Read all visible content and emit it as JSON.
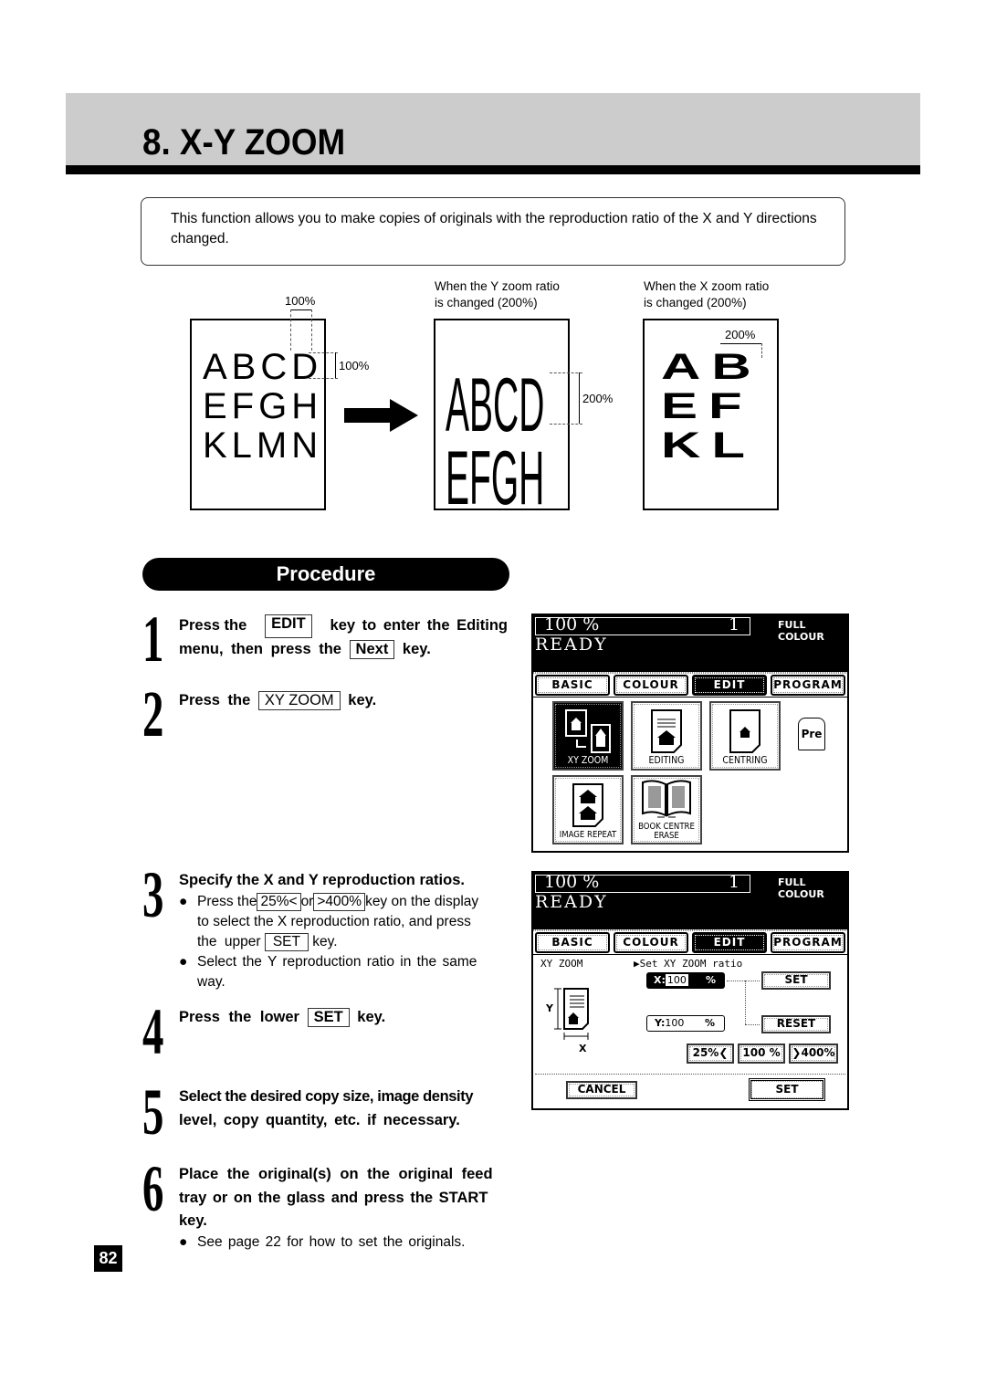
{
  "header": {
    "title": "8. X-Y ZOOM"
  },
  "intro": {
    "text": "This function allows you to make copies of originals with the reproduction ratio of the X and Y directions changed."
  },
  "diagram": {
    "original": {
      "width_label": "100%",
      "height_label": "100%",
      "lines": [
        "ABCD",
        "EFGH",
        "KLMN"
      ]
    },
    "y_changed": {
      "caption_line1": "When the Y zoom ratio",
      "caption_line2": "is changed (200%)",
      "height_label": "200%",
      "lines": [
        "ABCD",
        "EFGH"
      ]
    },
    "x_changed": {
      "caption_line1": "When the X zoom ratio",
      "caption_line2": "is changed (200%)",
      "width_label": "200%",
      "lines": [
        "AB",
        "EF",
        "KL"
      ]
    }
  },
  "procedure": {
    "title": "Procedure",
    "steps": [
      {
        "number": "1",
        "parts": [
          "Press the",
          "EDIT",
          "key to enter the Editing",
          "menu,  then press the",
          "Next",
          "key."
        ]
      },
      {
        "number": "2",
        "parts": [
          "Press the",
          "XY ZOOM",
          "key."
        ]
      },
      {
        "number": "3",
        "heading": "Specify the X and Y reproduction ratios.",
        "bullets": [
          {
            "parts": [
              "Press the",
              "25%<",
              "or",
              ">400%",
              "key on the display",
              "to select the X reproduction ratio, and press",
              "the upper",
              "SET",
              "key."
            ]
          },
          {
            "parts": [
              "Select the Y reproduction ratio in the same",
              "way."
            ]
          }
        ]
      },
      {
        "number": "4",
        "parts": [
          "Press the lower",
          "SET",
          "key."
        ]
      },
      {
        "number": "5",
        "lines": [
          "Select the desired copy size, image density",
          "level, copy quantity, etc. if necessary."
        ]
      },
      {
        "number": "6",
        "lines": [
          "Place the original(s) on the original feed",
          "tray or on the glass and press the START",
          "key."
        ],
        "bullet": "See page 22 for how to set the originals."
      }
    ]
  },
  "screen1": {
    "ratio": "100  %",
    "count": "1",
    "mode": "FULL COLOUR",
    "status": "READY",
    "tabs": [
      "BASIC",
      "COLOUR",
      "EDIT",
      "PROGRAM"
    ],
    "active_tab": "EDIT",
    "buttons": [
      "XY ZOOM",
      "EDITING",
      "CENTRING",
      "IMAGE REPEAT",
      "BOOK CENTRE",
      "ERASE"
    ],
    "pre_label": "Pre"
  },
  "screen2": {
    "ratio": "100  %",
    "count": "1",
    "mode": "FULL COLOUR",
    "status": "READY",
    "tabs": [
      "BASIC",
      "COLOUR",
      "EDIT",
      "PROGRAM"
    ],
    "active_tab": "EDIT",
    "section_title": "XY ZOOM",
    "instruction": "▶Set XY ZOOM ratio",
    "x_field": {
      "label": "X:",
      "value": "100",
      "unit": "%"
    },
    "y_field": {
      "label": "Y:",
      "value": "100",
      "unit": "%"
    },
    "set_upper": "SET",
    "reset": "RESET",
    "presets": [
      "25%❮",
      "100 %",
      "❯400%"
    ],
    "axis_y": "Y",
    "axis_x": "X",
    "cancel": "CANCEL",
    "set_lower": "SET"
  },
  "page_number": "82"
}
